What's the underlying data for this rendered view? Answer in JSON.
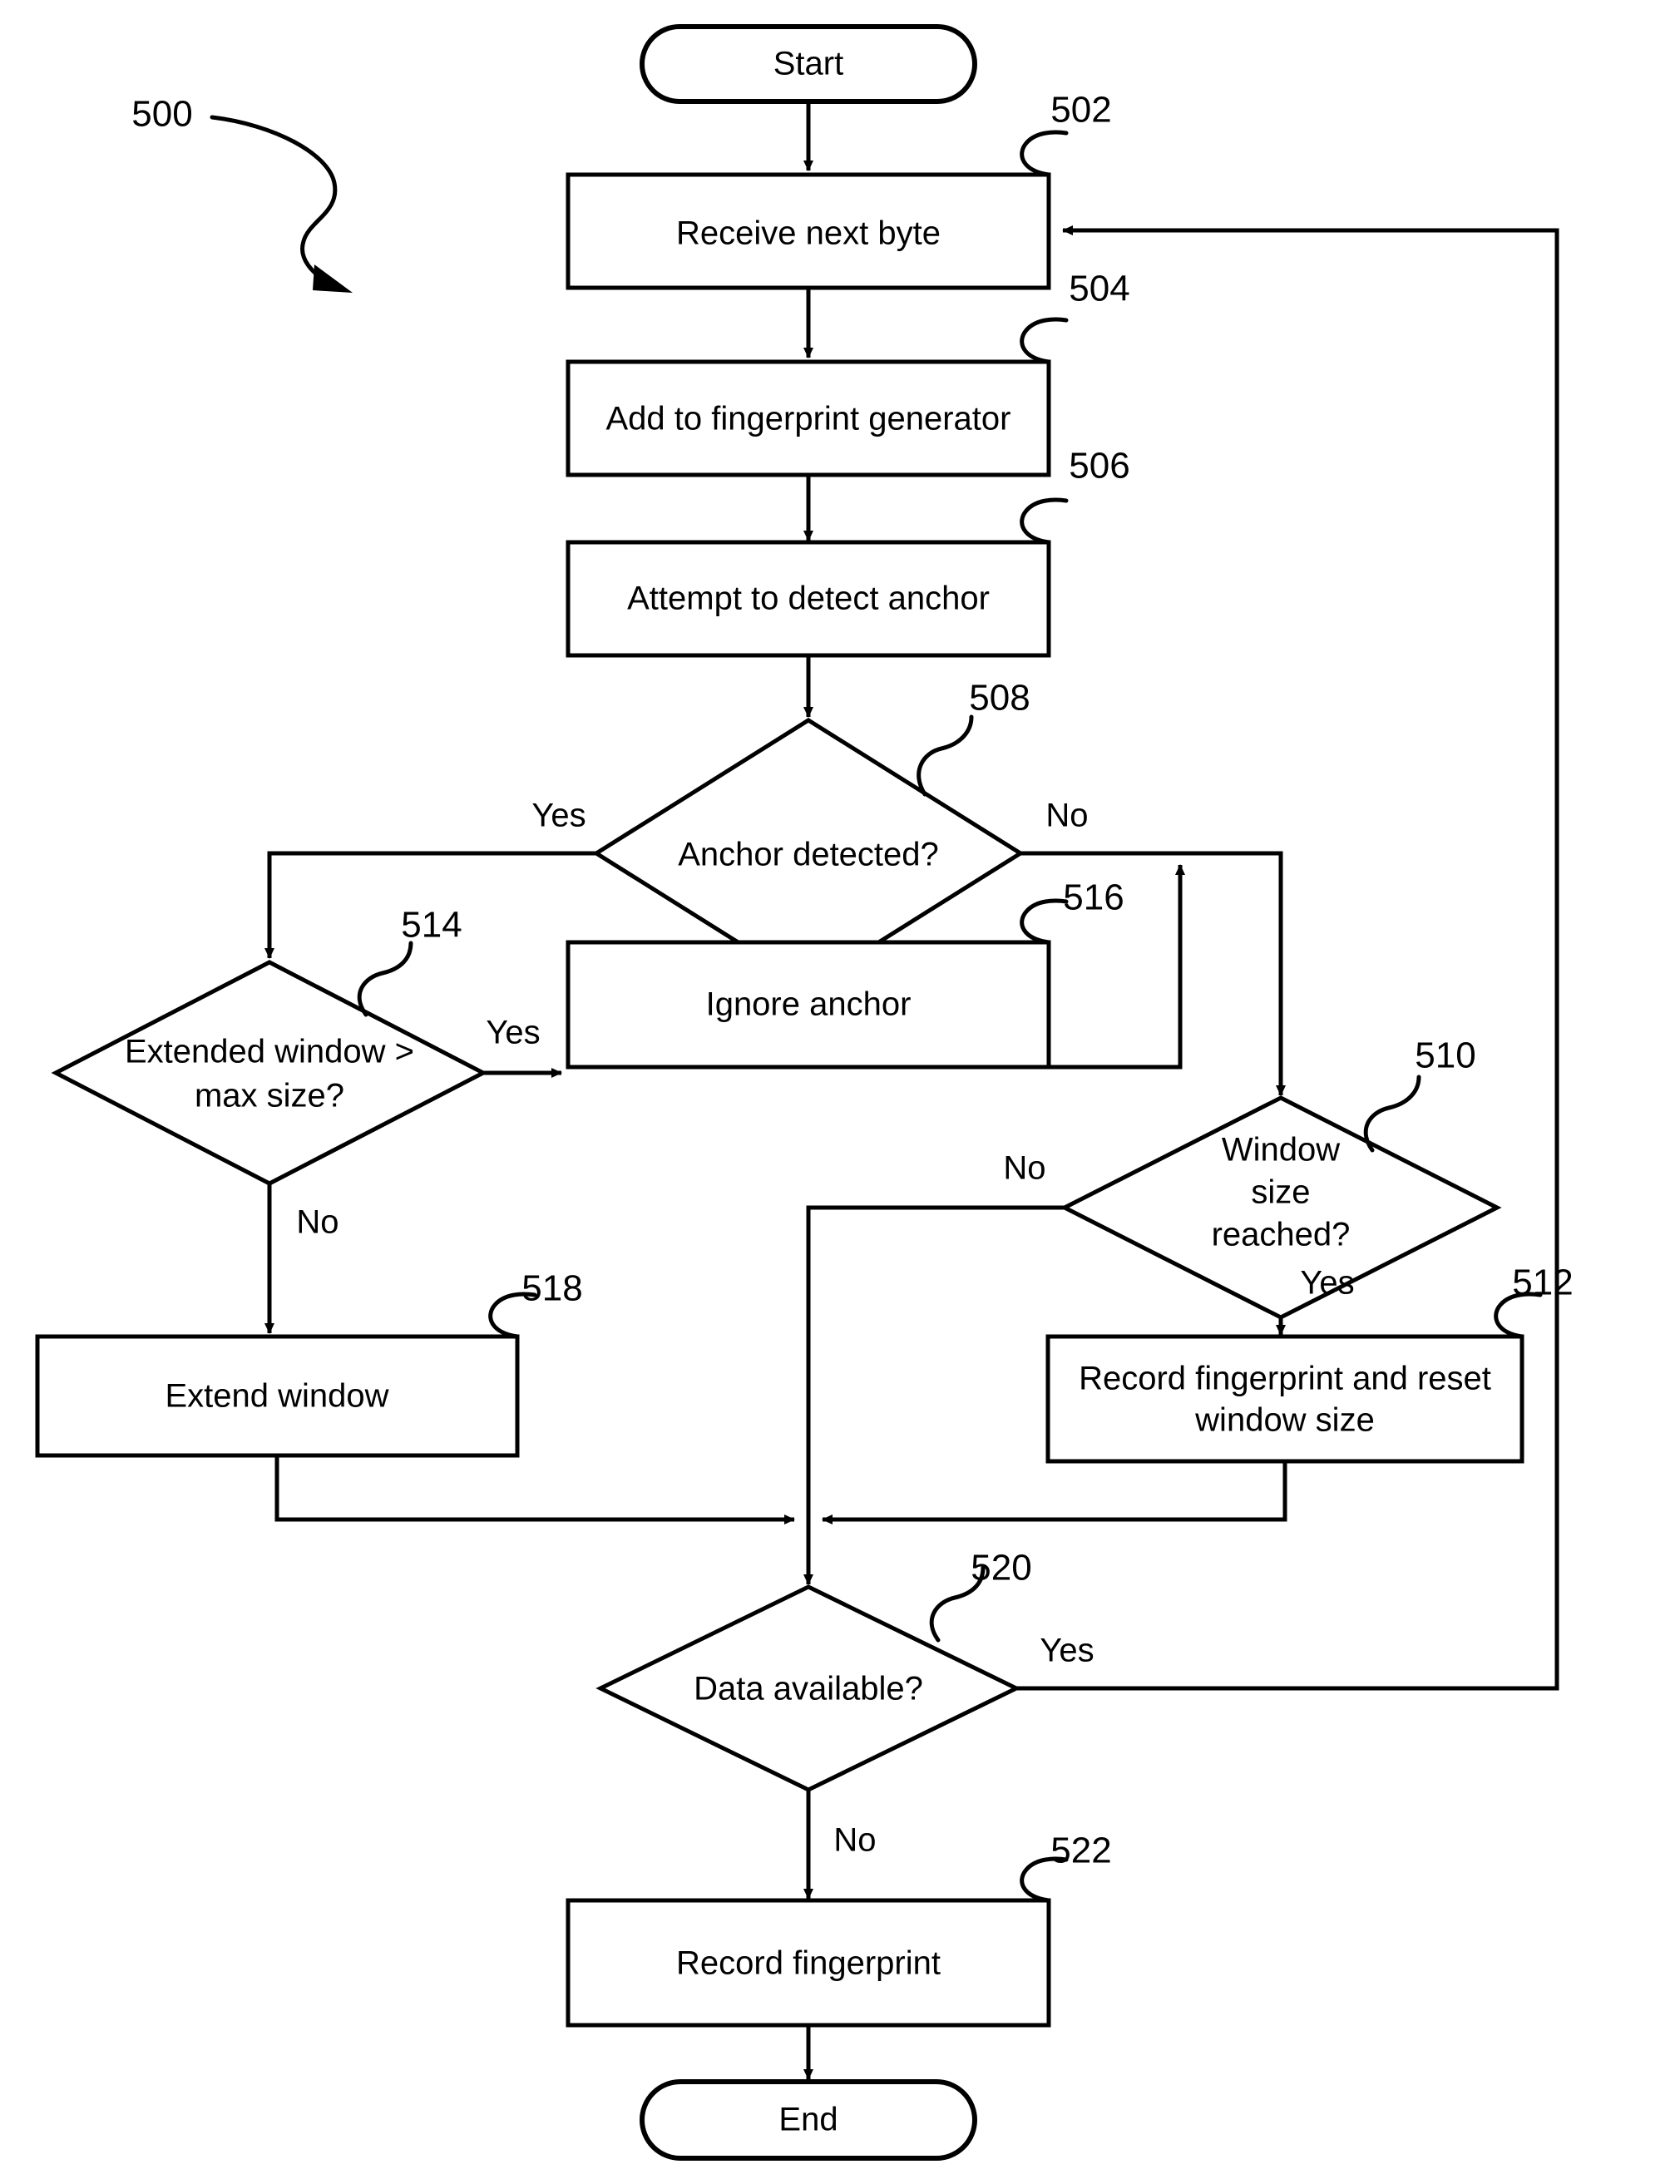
{
  "figure": {
    "figure_number": "500",
    "type": "flowchart"
  },
  "nodes": {
    "start": {
      "label": "Start",
      "shape": "terminator"
    },
    "n502": {
      "label": "Receive next byte",
      "ref": "502",
      "shape": "process"
    },
    "n504": {
      "label": "Add to fingerprint generator",
      "ref": "504",
      "shape": "process"
    },
    "n506": {
      "label": "Attempt to detect anchor",
      "ref": "506",
      "shape": "process"
    },
    "n508": {
      "label": "Anchor detected?",
      "ref": "508",
      "shape": "decision"
    },
    "n514": {
      "label_line1": "Extended window >",
      "label_line2": "max size?",
      "ref": "514",
      "shape": "decision"
    },
    "n516": {
      "label": "Ignore anchor",
      "ref": "516",
      "shape": "process"
    },
    "n510": {
      "label_line1": "Window",
      "label_line2": "size",
      "label_line3": "reached?",
      "ref": "510",
      "shape": "decision"
    },
    "n518": {
      "label": "Extend window",
      "ref": "518",
      "shape": "process"
    },
    "n512": {
      "label_line1": "Record fingerprint and reset",
      "label_line2": "window size",
      "ref": "512",
      "shape": "process"
    },
    "n520": {
      "label": "Data available?",
      "ref": "520",
      "shape": "decision"
    },
    "n522": {
      "label": "Record fingerprint",
      "ref": "522",
      "shape": "process"
    },
    "end": {
      "label": "End",
      "shape": "terminator"
    }
  },
  "edge_labels": {
    "anchor_yes": "Yes",
    "anchor_no": "No",
    "extended_yes": "Yes",
    "extended_no": "No",
    "window_no": "No",
    "window_yes": "Yes",
    "data_yes": "Yes",
    "data_no": "No"
  },
  "colors": {
    "stroke": "#000000",
    "fill": "#ffffff",
    "text": "#000000"
  }
}
